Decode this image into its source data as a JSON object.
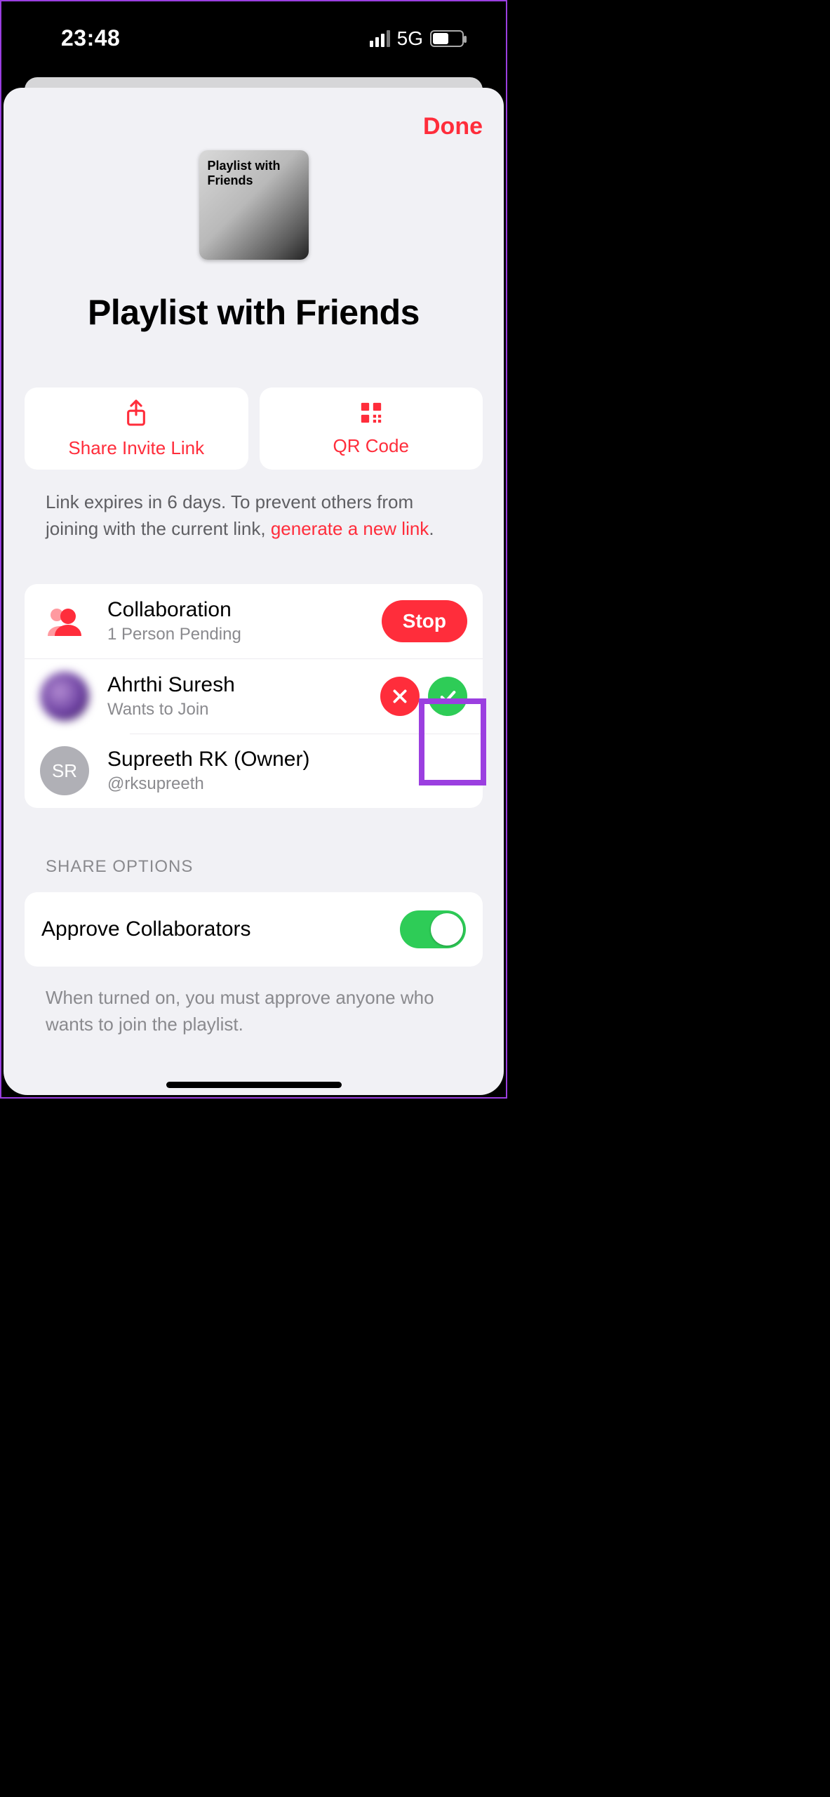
{
  "statusbar": {
    "time": "23:48",
    "network": "5G"
  },
  "sheet": {
    "done_label": "Done",
    "cover_text": "Playlist with Friends",
    "title": "Playlist with Friends"
  },
  "actions": {
    "share_label": "Share Invite Link",
    "qr_label": "QR Code"
  },
  "info": {
    "prefix": "Link expires in 6 days. To prevent others from joining with the current link, ",
    "link": "generate a new link",
    "suffix": "."
  },
  "collab": {
    "header_title": "Collaboration",
    "header_sub": "1 Person Pending",
    "stop_label": "Stop",
    "pending": {
      "name": "Ahrthi Suresh",
      "sub": "Wants to Join"
    },
    "owner": {
      "name": "Supreeth RK (Owner)",
      "handle": "@rksupreeth",
      "initials": "SR"
    }
  },
  "share_options": {
    "section_label": "SHARE OPTIONS",
    "approve_label": "Approve Collaborators",
    "helper": "When turned on, you must approve anyone who wants to join the playlist."
  }
}
